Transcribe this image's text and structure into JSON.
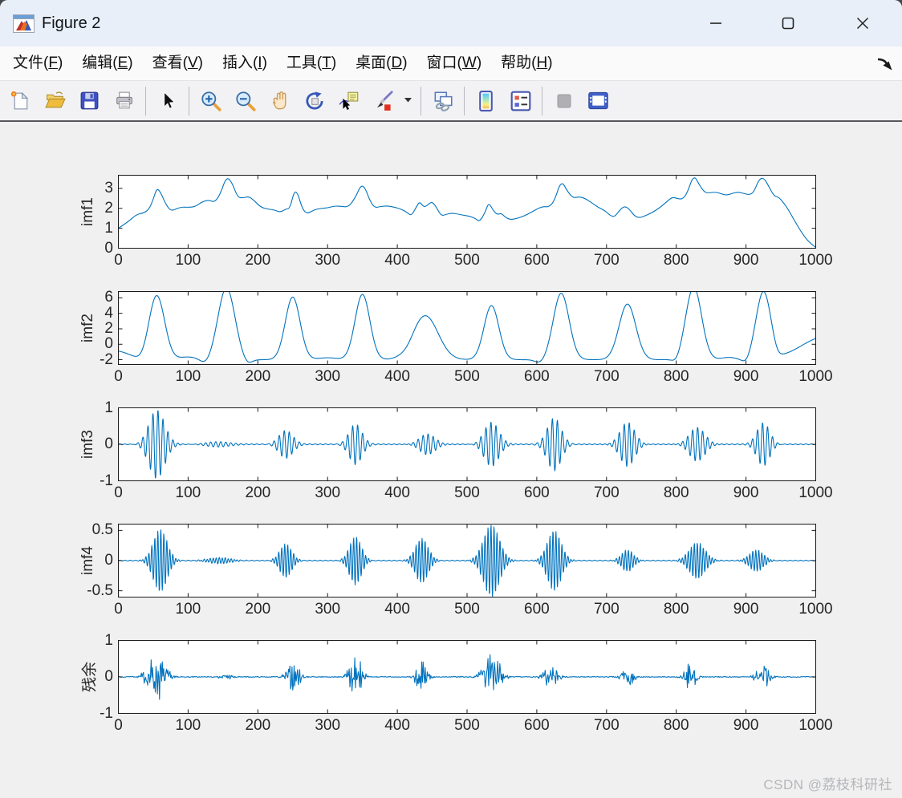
{
  "window": {
    "title": "Figure 2",
    "controls": [
      {
        "name": "minimize"
      },
      {
        "name": "maximize"
      },
      {
        "name": "close"
      }
    ]
  },
  "menu": {
    "items": [
      {
        "name": "file",
        "text": "文件",
        "key": "F"
      },
      {
        "name": "edit",
        "text": "编辑",
        "key": "E"
      },
      {
        "name": "view",
        "text": "查看",
        "key": "V"
      },
      {
        "name": "insert",
        "text": "插入",
        "key": "I"
      },
      {
        "name": "tools",
        "text": "工具",
        "key": "T"
      },
      {
        "name": "desktop",
        "text": "桌面",
        "key": "D"
      },
      {
        "name": "window",
        "text": "窗口",
        "key": "W"
      },
      {
        "name": "help",
        "text": "帮助",
        "key": "H"
      }
    ]
  },
  "toolbar": {
    "buttons": [
      {
        "name": "new-figure"
      },
      {
        "name": "open-file"
      },
      {
        "name": "save-figure"
      },
      {
        "name": "print-figure"
      },
      {
        "sep": true
      },
      {
        "name": "pointer"
      },
      {
        "sep": true
      },
      {
        "name": "zoom-in"
      },
      {
        "name": "zoom-out"
      },
      {
        "name": "pan"
      },
      {
        "name": "rotate-3d"
      },
      {
        "name": "data-cursor"
      },
      {
        "name": "brush"
      },
      {
        "name": "brush-dropdown",
        "narrow": true
      },
      {
        "sep": true
      },
      {
        "name": "link-plot"
      },
      {
        "sep": true
      },
      {
        "name": "insert-colorbar"
      },
      {
        "name": "insert-legend"
      },
      {
        "sep": true
      },
      {
        "name": "hide-plot-tools",
        "disabled": true
      },
      {
        "name": "dock-figure"
      }
    ]
  },
  "watermark": "CSDN @荔枝科研社",
  "colors": {
    "line": "#0072BD",
    "axis": "#1a1a1a",
    "tick_label": "#262626",
    "titlebar_bg": "#e9eff8",
    "figure_bg": "#f0f0f0"
  },
  "chart_data": [
    {
      "type": "line",
      "ylabel": "imf1",
      "xlim": [
        0,
        1000
      ],
      "ylim": [
        0,
        3.66
      ],
      "xticks": [
        0,
        100,
        200,
        300,
        400,
        500,
        600,
        700,
        800,
        900,
        1000
      ],
      "yticks": [
        0,
        1,
        2,
        3
      ],
      "box": true,
      "grid": false,
      "line_color": "#0072BD",
      "signal": {
        "kind": "spline",
        "points": [
          [
            0,
            1.0
          ],
          [
            14,
            1.32
          ],
          [
            26,
            1.7
          ],
          [
            36,
            1.76
          ],
          [
            44,
            1.95
          ],
          [
            50,
            2.45
          ],
          [
            55,
            3.0
          ],
          [
            60,
            2.85
          ],
          [
            68,
            2.2
          ],
          [
            75,
            1.88
          ],
          [
            82,
            1.95
          ],
          [
            90,
            2.07
          ],
          [
            100,
            2.05
          ],
          [
            110,
            2.08
          ],
          [
            120,
            2.33
          ],
          [
            130,
            2.42
          ],
          [
            138,
            2.3
          ],
          [
            146,
            2.7
          ],
          [
            155,
            3.6
          ],
          [
            163,
            3.3
          ],
          [
            171,
            2.55
          ],
          [
            179,
            2.52
          ],
          [
            187,
            2.6
          ],
          [
            195,
            2.38
          ],
          [
            204,
            2.06
          ],
          [
            214,
            1.96
          ],
          [
            224,
            1.92
          ],
          [
            232,
            1.8
          ],
          [
            240,
            1.96
          ],
          [
            246,
            2.0
          ],
          [
            252,
            2.85
          ],
          [
            257,
            2.78
          ],
          [
            264,
            1.95
          ],
          [
            271,
            1.72
          ],
          [
            280,
            1.92
          ],
          [
            290,
            2.0
          ],
          [
            300,
            2.02
          ],
          [
            310,
            2.12
          ],
          [
            320,
            2.1
          ],
          [
            330,
            2.06
          ],
          [
            340,
            2.55
          ],
          [
            348,
            3.18
          ],
          [
            354,
            3.02
          ],
          [
            361,
            2.35
          ],
          [
            368,
            2.02
          ],
          [
            376,
            2.1
          ],
          [
            386,
            2.12
          ],
          [
            396,
            2.06
          ],
          [
            406,
            1.95
          ],
          [
            414,
            1.8
          ],
          [
            420,
            1.62
          ],
          [
            427,
            2.05
          ],
          [
            432,
            2.35
          ],
          [
            438,
            2.05
          ],
          [
            444,
            2.18
          ],
          [
            450,
            2.35
          ],
          [
            457,
            2.0
          ],
          [
            463,
            1.62
          ],
          [
            470,
            1.7
          ],
          [
            478,
            1.76
          ],
          [
            486,
            1.72
          ],
          [
            494,
            1.66
          ],
          [
            504,
            1.6
          ],
          [
            512,
            1.5
          ],
          [
            518,
            1.32
          ],
          [
            526,
            1.8
          ],
          [
            531,
            2.3
          ],
          [
            537,
            1.92
          ],
          [
            543,
            1.68
          ],
          [
            549,
            1.76
          ],
          [
            556,
            1.52
          ],
          [
            563,
            1.43
          ],
          [
            572,
            1.5
          ],
          [
            582,
            1.62
          ],
          [
            592,
            1.8
          ],
          [
            602,
            2.0
          ],
          [
            610,
            2.1
          ],
          [
            617,
            2.06
          ],
          [
            625,
            2.35
          ],
          [
            635,
            3.42
          ],
          [
            644,
            2.85
          ],
          [
            652,
            2.52
          ],
          [
            660,
            2.58
          ],
          [
            668,
            2.52
          ],
          [
            678,
            2.3
          ],
          [
            688,
            2.05
          ],
          [
            698,
            1.88
          ],
          [
            706,
            1.62
          ],
          [
            712,
            1.58
          ],
          [
            719,
            1.92
          ],
          [
            726,
            2.12
          ],
          [
            733,
            1.95
          ],
          [
            740,
            1.62
          ],
          [
            747,
            1.52
          ],
          [
            755,
            1.62
          ],
          [
            765,
            1.78
          ],
          [
            776,
            2.02
          ],
          [
            786,
            2.32
          ],
          [
            794,
            2.56
          ],
          [
            801,
            2.5
          ],
          [
            808,
            2.45
          ],
          [
            815,
            2.7
          ],
          [
            825,
            3.7
          ],
          [
            833,
            3.18
          ],
          [
            841,
            2.78
          ],
          [
            849,
            2.78
          ],
          [
            857,
            2.82
          ],
          [
            865,
            2.72
          ],
          [
            873,
            2.66
          ],
          [
            881,
            2.76
          ],
          [
            889,
            2.82
          ],
          [
            897,
            2.74
          ],
          [
            905,
            2.68
          ],
          [
            911,
            2.8
          ],
          [
            919,
            3.48
          ],
          [
            926,
            3.52
          ],
          [
            933,
            3.08
          ],
          [
            940,
            2.62
          ],
          [
            947,
            2.56
          ],
          [
            953,
            2.32
          ],
          [
            960,
            1.98
          ],
          [
            969,
            1.42
          ],
          [
            978,
            0.88
          ],
          [
            988,
            0.38
          ],
          [
            1000,
            0.04
          ]
        ]
      }
    },
    {
      "type": "line",
      "ylabel": "imf2",
      "xlim": [
        0,
        1000
      ],
      "ylim": [
        -2.62,
        6.82
      ],
      "xticks": [
        0,
        100,
        200,
        300,
        400,
        500,
        600,
        700,
        800,
        900,
        1000
      ],
      "yticks": [
        -2,
        0,
        2,
        4,
        6
      ],
      "box": true,
      "grid": false,
      "line_color": "#0072BD",
      "signal": {
        "kind": "gauss-peaks",
        "baseline": -2,
        "peaks": [
          {
            "c": -8,
            "h": 1.2,
            "w": 32
          },
          {
            "c": 55,
            "h": 8.3,
            "w": 16
          },
          {
            "c": 100,
            "h": 0.35,
            "w": 18
          },
          {
            "c": 155,
            "h": 9.3,
            "w": 17
          },
          {
            "c": 250,
            "h": 8.1,
            "w": 15
          },
          {
            "c": 300,
            "h": 0.25,
            "w": 20
          },
          {
            "c": 350,
            "h": 8.45,
            "w": 15
          },
          {
            "c": 440,
            "h": 5.7,
            "w": 26
          },
          {
            "c": 535,
            "h": 7.0,
            "w": 15
          },
          {
            "c": 635,
            "h": 8.6,
            "w": 16
          },
          {
            "c": 730,
            "h": 7.2,
            "w": 17
          },
          {
            "c": 825,
            "h": 9.4,
            "w": 16
          },
          {
            "c": 875,
            "h": 0.3,
            "w": 15
          },
          {
            "c": 925,
            "h": 8.7,
            "w": 15
          },
          {
            "c": 1015,
            "h": 3.0,
            "w": 50
          }
        ],
        "dips": [
          {
            "c": 35,
            "h": 0.45,
            "w": 12
          },
          {
            "c": 125,
            "h": 0.55,
            "w": 10
          },
          {
            "c": 185,
            "h": 0.6,
            "w": 9
          },
          {
            "c": 415,
            "h": 0.3,
            "w": 12
          },
          {
            "c": 605,
            "h": 0.45,
            "w": 10
          },
          {
            "c": 800,
            "h": 0.5,
            "w": 8
          },
          {
            "c": 900,
            "h": 0.5,
            "w": 8
          },
          {
            "c": 945,
            "h": 0.45,
            "w": 8
          }
        ]
      }
    },
    {
      "type": "line",
      "ylabel": "imf3",
      "xlim": [
        0,
        1000
      ],
      "ylim": [
        -1,
        1
      ],
      "xticks": [
        0,
        100,
        200,
        300,
        400,
        500,
        600,
        700,
        800,
        900,
        1000
      ],
      "yticks": [
        -1,
        0,
        1
      ],
      "box": true,
      "grid": false,
      "line_color": "#0072BD",
      "signal": {
        "kind": "bursts",
        "carrier_period": 7.2,
        "ripple": 0.012,
        "bursts": [
          {
            "c": 55,
            "a": 0.95,
            "w": 16,
            "p": 0.0
          },
          {
            "c": 140,
            "a": 0.07,
            "w": 25,
            "p": 1.7
          },
          {
            "c": 240,
            "a": 0.38,
            "w": 14,
            "p": 3.4
          },
          {
            "c": 340,
            "a": 0.55,
            "w": 13,
            "p": 5.1
          },
          {
            "c": 443,
            "a": 0.3,
            "w": 16,
            "p": 0.5
          },
          {
            "c": 535,
            "a": 0.62,
            "w": 15,
            "p": 2.2
          },
          {
            "c": 625,
            "a": 0.72,
            "w": 14,
            "p": 3.9
          },
          {
            "c": 730,
            "a": 0.62,
            "w": 15,
            "p": 5.6
          },
          {
            "c": 830,
            "a": 0.48,
            "w": 16,
            "p": 1.0
          },
          {
            "c": 925,
            "a": 0.6,
            "w": 13,
            "p": 2.7
          }
        ]
      }
    },
    {
      "type": "line",
      "ylabel": "imf4",
      "xlim": [
        0,
        1000
      ],
      "ylim": [
        -0.605,
        0.605
      ],
      "xticks": [
        0,
        100,
        200,
        300,
        400,
        500,
        600,
        700,
        800,
        900,
        1000
      ],
      "yticks": [
        -0.5,
        0,
        0.5
      ],
      "box": true,
      "grid": false,
      "line_color": "#0072BD",
      "signal": {
        "kind": "bursts",
        "carrier_period": 4.3,
        "ripple": 0.006,
        "bursts": [
          {
            "c": 60,
            "a": 0.52,
            "w": 14,
            "p": 0.3
          },
          {
            "c": 145,
            "a": 0.05,
            "w": 22,
            "p": 2.0
          },
          {
            "c": 240,
            "a": 0.28,
            "w": 12,
            "p": 3.7
          },
          {
            "c": 340,
            "a": 0.4,
            "w": 12,
            "p": 5.4
          },
          {
            "c": 435,
            "a": 0.37,
            "w": 13,
            "p": 0.8
          },
          {
            "c": 535,
            "a": 0.6,
            "w": 16,
            "p": 2.5
          },
          {
            "c": 625,
            "a": 0.5,
            "w": 14,
            "p": 4.2
          },
          {
            "c": 730,
            "a": 0.18,
            "w": 12,
            "p": 5.9
          },
          {
            "c": 830,
            "a": 0.3,
            "w": 16,
            "p": 1.3
          },
          {
            "c": 915,
            "a": 0.18,
            "w": 14,
            "p": 3.0
          }
        ]
      }
    },
    {
      "type": "line",
      "ylabel": "残余",
      "xlim": [
        0,
        1000
      ],
      "ylim": [
        -1,
        1
      ],
      "xticks": [
        0,
        100,
        200,
        300,
        400,
        500,
        600,
        700,
        800,
        900,
        1000
      ],
      "yticks": [
        -1,
        0,
        1
      ],
      "box": true,
      "grid": false,
      "line_color": "#0072BD",
      "signal": {
        "kind": "noise-bursts",
        "seed": 7,
        "bursts": [
          {
            "c": 55,
            "a": 0.55,
            "w": 16
          },
          {
            "c": 155,
            "a": 0.07,
            "w": 12
          },
          {
            "c": 250,
            "a": 0.35,
            "w": 12
          },
          {
            "c": 340,
            "a": 0.75,
            "w": 10
          },
          {
            "c": 435,
            "a": 0.4,
            "w": 10
          },
          {
            "c": 535,
            "a": 0.75,
            "w": 14
          },
          {
            "c": 620,
            "a": 0.3,
            "w": 12
          },
          {
            "c": 730,
            "a": 0.3,
            "w": 10
          },
          {
            "c": 820,
            "a": 0.4,
            "w": 10
          },
          {
            "c": 925,
            "a": 0.32,
            "w": 12
          }
        ]
      }
    }
  ]
}
